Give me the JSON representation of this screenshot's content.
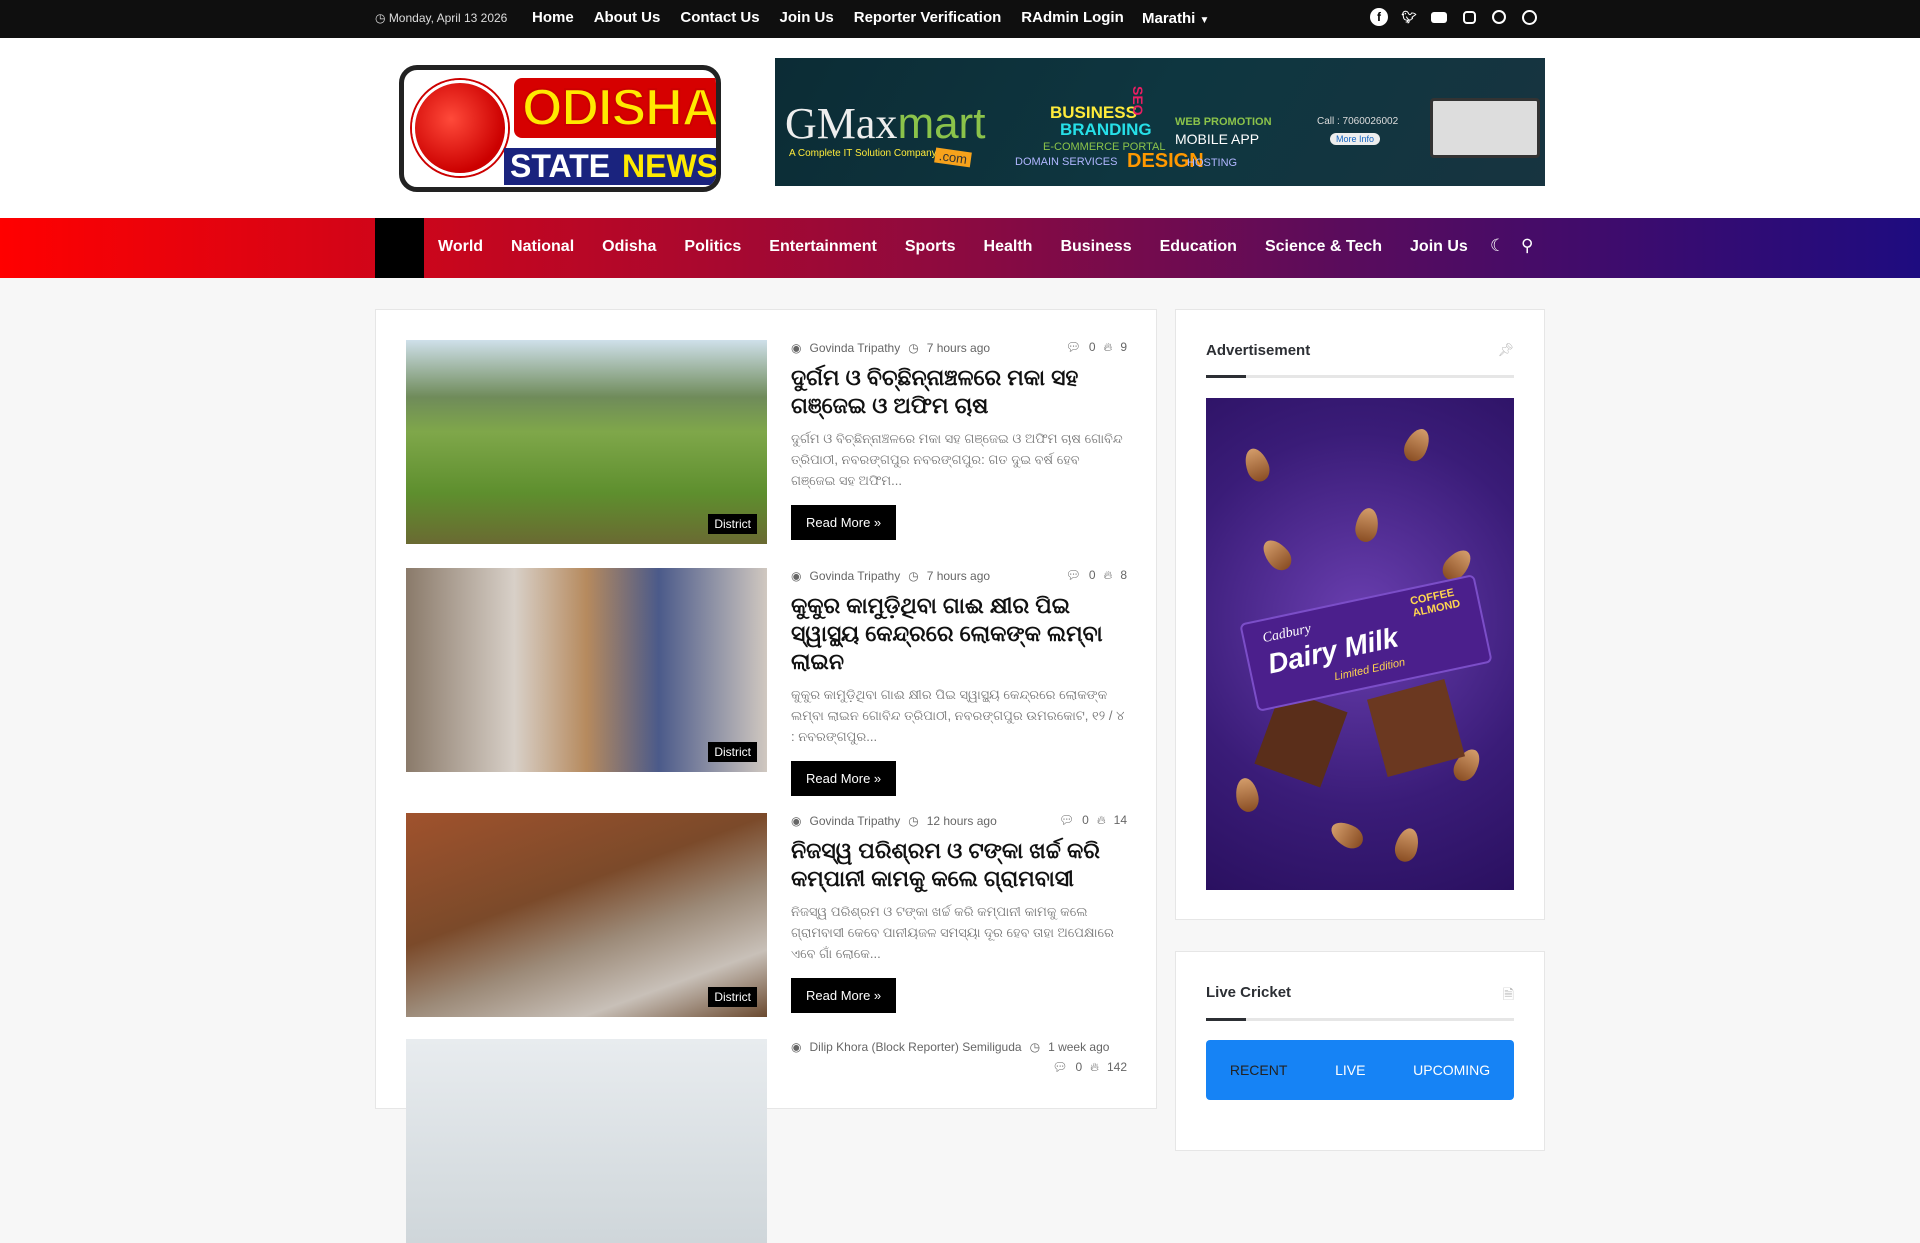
{
  "topbar": {
    "date": "Monday, April 13 2026",
    "links": [
      "Home",
      "About Us",
      "Contact Us",
      "Join Us",
      "Reporter Verification",
      "RAdmin Login"
    ],
    "language": "Marathi",
    "social": [
      "facebook-icon",
      "twitter-icon",
      "youtube-icon",
      "instagram-icon",
      "whatsapp-icon",
      "user-icon"
    ]
  },
  "logo": {
    "line1": "ODISHA",
    "line2": "STATE",
    "line3": "NEWS"
  },
  "banner": {
    "brand": "GMax",
    "brand2": "mart",
    "tagline": "A Complete IT Solution Company",
    "com": ".com",
    "words": [
      "BUSINESS",
      "BRANDING",
      "E-COMMERCE PORTAL",
      "DOMAIN SERVICES",
      "DESIGN",
      "WEB PROMOTION",
      "MOBILE APP",
      "HOSTING",
      "SEO"
    ],
    "call": "Call : 7060026002",
    "more": "More Info"
  },
  "nav": {
    "items": [
      "World",
      "National",
      "Odisha",
      "Politics",
      "Entertainment",
      "Sports",
      "Health",
      "Business",
      "Education",
      "Science & Tech",
      "Join Us"
    ]
  },
  "articles": [
    {
      "author": "Govinda Tripathy",
      "time": "7 hours ago",
      "comments": "0",
      "views": "9",
      "title": "ଦୁର୍ଗମ ଓ ବିଚ୍ଛିନ୍ନାଞ୍ଚଳରେ ମକା ସହ ଗଞ୍ଜେଇ ଓ ଅଫିମ ଚାଷ",
      "excerpt": "ଦୁର୍ଗମ ଓ ବିଚ୍ଛିନ୍ନାଞ୍ଚଳରେ ମକା ସହ ଗଞ୍ଜେଇ ଓ ଅଫିମ ଚାଷ ଗୋବିନ୍ଦ ତ୍ରିପାଠୀ, ନବରଙ୍ଗପୁର ନବରଙ୍ଗପୁର: ଗତ ଦୁଇ ବର୍ଷ ହେବ ଗଞ୍ଜେଇ ସହ ଅଫିମ...",
      "category": "District",
      "read_more": "Read More »"
    },
    {
      "author": "Govinda Tripathy",
      "time": "7 hours ago",
      "comments": "0",
      "views": "8",
      "title": "କୁକୁର କାମୁଡ଼ିଥିବା ଗାଈ କ୍ଷୀର ପିଇ ସ୍ୱାସ୍ଥ୍ୟ କେନ୍ଦ୍ରରେ ଲୋକଙ୍କ ଲମ୍ବା ଲାଇନ",
      "excerpt": "କୁକୁର କାମୁଡ଼ିଥିବା ଗାଈ କ୍ଷୀର ପିଇ ସ୍ୱାସ୍ଥ୍ୟ କେନ୍ଦ୍ରରେ ଲୋକଙ୍କ ଲମ୍ବା ଲାଇନ ଗୋବିନ୍ଦ ତ୍ରିପାଠୀ, ନବରଙ୍ଗପୁର ଉମରକୋଟ, ୧୨ / ୪ : ନବରଙ୍ଗପୁର...",
      "category": "District",
      "read_more": "Read More »"
    },
    {
      "author": "Govinda Tripathy",
      "time": "12 hours ago",
      "comments": "0",
      "views": "14",
      "title": "ନିଜସ୍ୱ ପରିଶ୍ରମ ଓ ଟଙ୍କା ଖର୍ଚ୍ଚ କରି କମ୍ପାନୀ କାମକୁ କଲେ ଗ୍ରାମବାସୀ",
      "excerpt": "ନିଜସ୍ୱ ପରିଶ୍ରମ ଓ ଟଙ୍କା ଖର୍ଚ୍ଚ କରି କମ୍ପାନୀ କାମକୁ କଲେ ଗ୍ରାମବାସୀ କେବେ ପାନୀୟଜଳ ସମସ୍ୟା ଦୂର ହେବ ତାହା ଅପେକ୍ଷାରେ ଏବେ ଗାଁ ଲୋକେ...",
      "category": "District",
      "read_more": "Read More »"
    },
    {
      "author": "Dilip Khora (Block Reporter) Semiliguda",
      "time": "1 week ago",
      "comments": "0",
      "views": "142"
    }
  ],
  "sidebar": {
    "ad_title": "Advertisement",
    "ad": {
      "brand": "Cadbury",
      "product": "Dairy Milk",
      "edition": "Limited Edition",
      "flavor": "COFFEE ALMOND"
    },
    "cricket_title": "Live Cricket",
    "tabs": [
      "RECENT",
      "LIVE",
      "UPCOMING"
    ]
  }
}
